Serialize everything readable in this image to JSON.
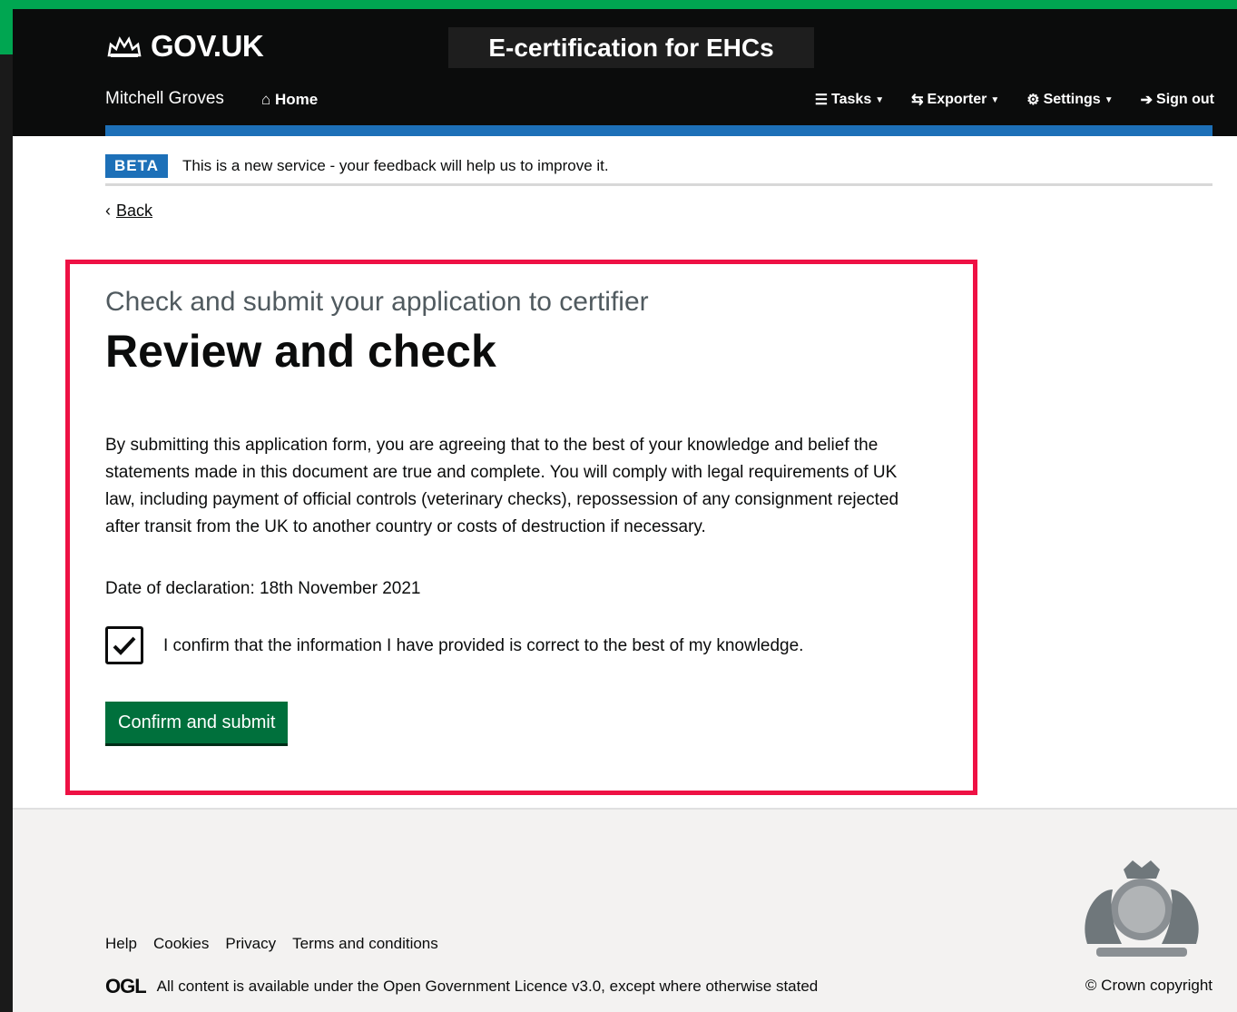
{
  "header": {
    "logo_text": "GOV.UK",
    "service_name": "E-certification for EHCs",
    "user_name": "Mitchell Groves",
    "home_label": "Home",
    "nav": [
      {
        "label": "Tasks",
        "icon": "list-icon"
      },
      {
        "label": "Exporter",
        "icon": "swap-icon"
      },
      {
        "label": "Settings",
        "icon": "gear-icon"
      },
      {
        "label": "Sign out",
        "icon": "sign-out-icon"
      }
    ]
  },
  "banner": {
    "tag": "BETA",
    "text": "This is a new service - your feedback will help us to improve it."
  },
  "back_link": "Back",
  "main": {
    "caption": "Check and submit your application to certifier",
    "title": "Review and check",
    "declaration": "By submitting this application form, you are agreeing that to the best of your knowledge and belief the statements made in this document are true and complete. You will comply with legal requirements of UK law, including payment of official controls (veterinary checks), repossession of any consignment rejected after transit from the UK to another country or costs of destruction if necessary.",
    "date_of_declaration": "Date of declaration: 18th November 2021",
    "confirm_checked": true,
    "confirm_label": "I confirm that the information I have provided is correct to the best of my knowledge.",
    "submit_label": "Confirm and submit"
  },
  "footer": {
    "links": [
      "Help",
      "Cookies",
      "Privacy",
      "Terms and conditions"
    ],
    "ogl_logo": "OGL",
    "licence_text": "All content is available under the Open Government Licence v3.0, except where otherwise stated",
    "copyright": "© Crown copyright"
  },
  "colors": {
    "accent_green": "#00a651",
    "govuk_blue": "#1d70b8",
    "button_green": "#00703c",
    "highlight_red": "#ee1144"
  }
}
